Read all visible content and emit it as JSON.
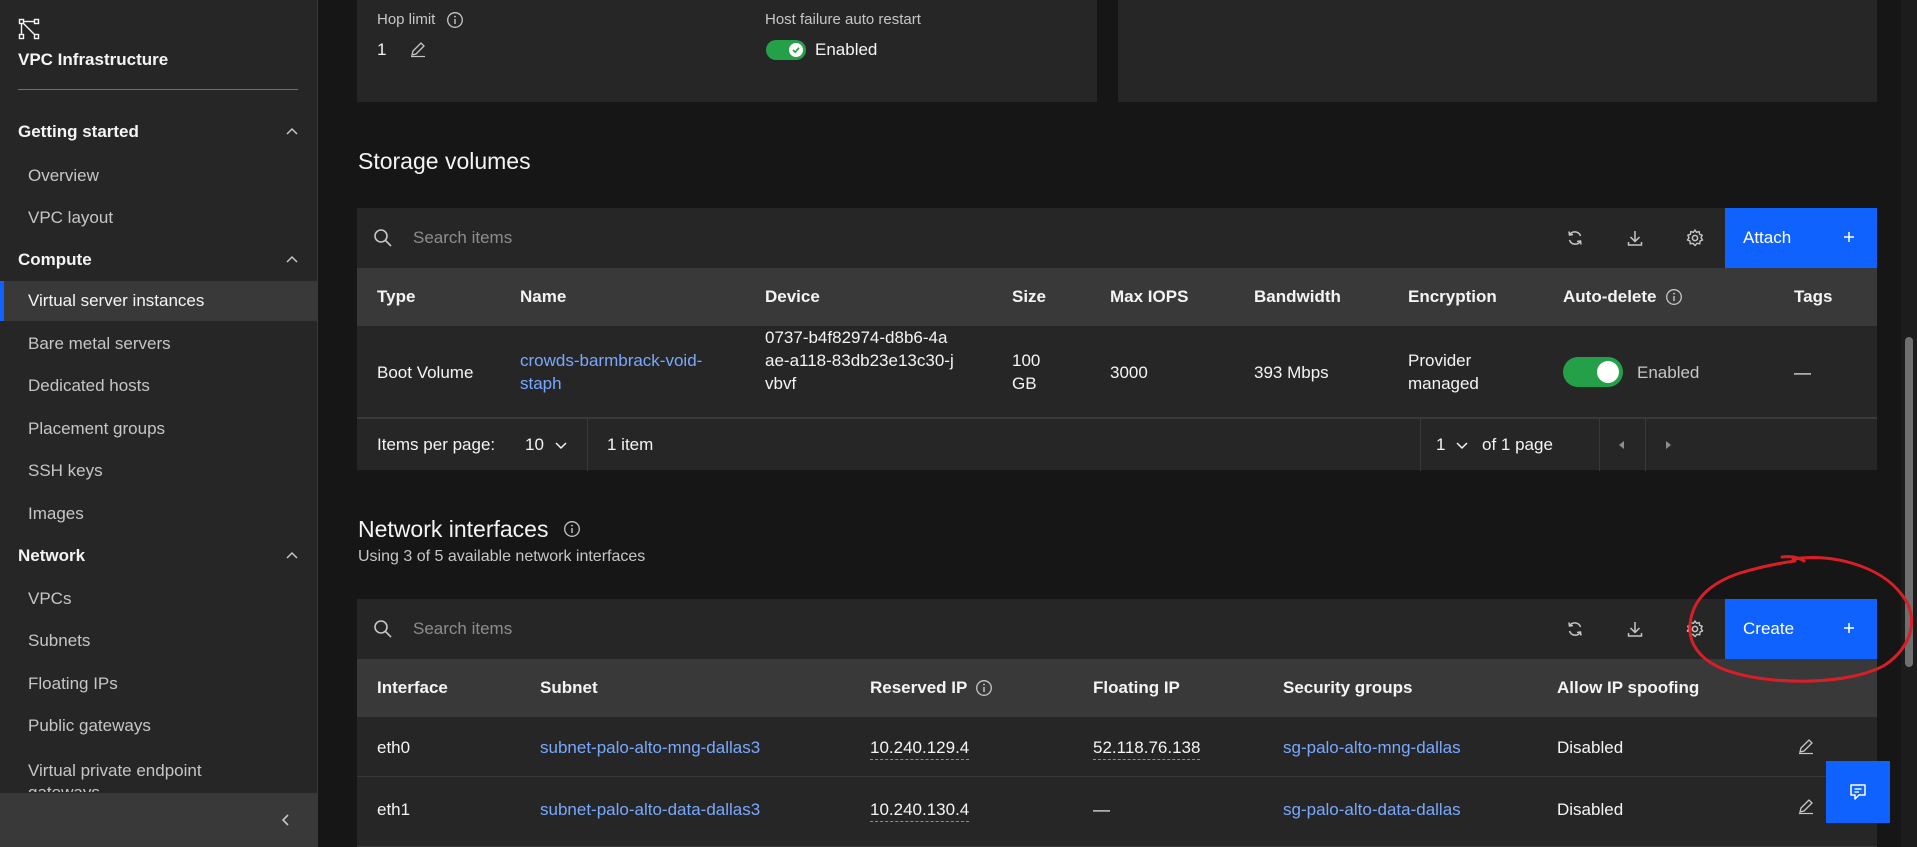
{
  "sidebar": {
    "title": "VPC Infrastructure",
    "sections": [
      {
        "label": "Getting started",
        "items": [
          "Overview",
          "VPC layout"
        ]
      },
      {
        "label": "Compute",
        "items": [
          "Virtual server instances",
          "Bare metal servers",
          "Dedicated hosts",
          "Placement groups",
          "SSH keys",
          "Images"
        ]
      },
      {
        "label": "Network",
        "items": [
          "VPCs",
          "Subnets",
          "Floating IPs",
          "Public gateways",
          "Virtual private endpoint gateways"
        ]
      }
    ],
    "active_item": "Virtual server instances"
  },
  "details": {
    "hop_limit_label": "Hop limit",
    "hop_limit_value": "1",
    "auto_restart_label": "Host failure auto restart",
    "auto_restart_value": "Enabled"
  },
  "storage": {
    "title": "Storage volumes",
    "search_placeholder": "Search items",
    "attach_label": "Attach",
    "columns": [
      "Type",
      "Name",
      "Device",
      "Size",
      "Max IOPS",
      "Bandwidth",
      "Encryption",
      "Auto-delete",
      "Tags"
    ],
    "row": {
      "type": "Boot Volume",
      "name": "crowds-barmbrack-void-staph",
      "device": "0737-b4f82974-d8b6-4aae-a118-83db23e13c30-jvbvf",
      "size": "100 GB",
      "max_iops": "3000",
      "bandwidth": "393 Mbps",
      "encryption": "Provider managed",
      "auto_delete": "Enabled",
      "tags": "—"
    },
    "pagination": {
      "items_per_page_label": "Items per page:",
      "items_per_page": "10",
      "item_count": "1 item",
      "page": "1",
      "of_pages": "of 1 page"
    }
  },
  "network": {
    "title": "Network interfaces",
    "subtitle": "Using 3 of 5 available network interfaces",
    "search_placeholder": "Search items",
    "create_label": "Create",
    "columns": [
      "Interface",
      "Subnet",
      "Reserved IP",
      "Floating IP",
      "Security groups",
      "Allow IP spoofing"
    ],
    "rows": [
      {
        "interface": "eth0",
        "subnet": "subnet-palo-alto-mng-dallas3",
        "reserved_ip": "10.240.129.4",
        "floating_ip": "52.118.76.138",
        "security_groups": "sg-palo-alto-mng-dallas",
        "spoofing": "Disabled"
      },
      {
        "interface": "eth1",
        "subnet": "subnet-palo-alto-data-dallas3",
        "reserved_ip": "10.240.130.4",
        "floating_ip": "—",
        "security_groups": "sg-palo-alto-data-dallas",
        "spoofing": "Disabled"
      }
    ]
  },
  "colors": {
    "accent": "#0f62fe",
    "link": "#78a9ff",
    "toggle_on": "#24a148",
    "annotation": "#da1e28"
  },
  "icons": [
    "vpc-logo-icon",
    "chevron-up-icon",
    "chevron-left-icon",
    "info-icon",
    "edit-icon",
    "checkmark-icon",
    "search-icon",
    "refresh-icon",
    "download-icon",
    "settings-icon",
    "add-icon",
    "chevron-down-icon",
    "caret-left-icon",
    "caret-right-icon",
    "chat-icon"
  ]
}
